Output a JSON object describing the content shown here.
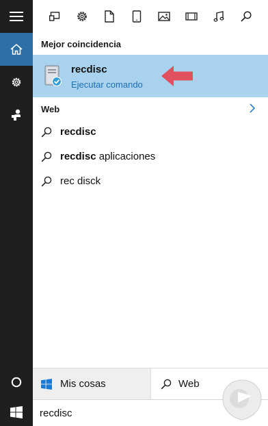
{
  "sidebar": {
    "items": [
      {
        "icon": "hamburger-menu-icon",
        "active": false
      },
      {
        "icon": "home-icon",
        "active": true
      },
      {
        "icon": "gear-icon",
        "active": false
      },
      {
        "icon": "feedback-icon",
        "active": false
      },
      {
        "icon": "cortana-circle-icon",
        "active": false
      },
      {
        "icon": "windows-logo-icon",
        "active": false
      }
    ]
  },
  "toolbar": {
    "filters": [
      "apps-filter-icon",
      "settings-filter-icon",
      "documents-filter-icon",
      "tablet-filter-icon",
      "photos-filter-icon",
      "videos-filter-icon",
      "music-filter-icon",
      "web-search-filter-icon"
    ]
  },
  "best_match": {
    "header": "Mejor coincidencia",
    "title": "recdisc",
    "subtitle": "Ejecutar comando",
    "icon": "recdisc-program-icon",
    "annotation": "red-arrow-icon"
  },
  "web": {
    "header": "Web",
    "results": [
      {
        "bold": "recdisc",
        "rest": ""
      },
      {
        "bold": "recdisc",
        "rest": " aplicaciones"
      },
      {
        "bold": "",
        "rest": "rec disck"
      }
    ]
  },
  "scope": {
    "mine_label": "Mis cosas",
    "web_label": "Web"
  },
  "search": {
    "value": "recdisc"
  },
  "colors": {
    "rail": "#1f1f1f",
    "rail_active": "#2d6fa8",
    "highlight": "#a9d2ef",
    "link": "#1a6fb5",
    "arrow": "#e0505f"
  }
}
